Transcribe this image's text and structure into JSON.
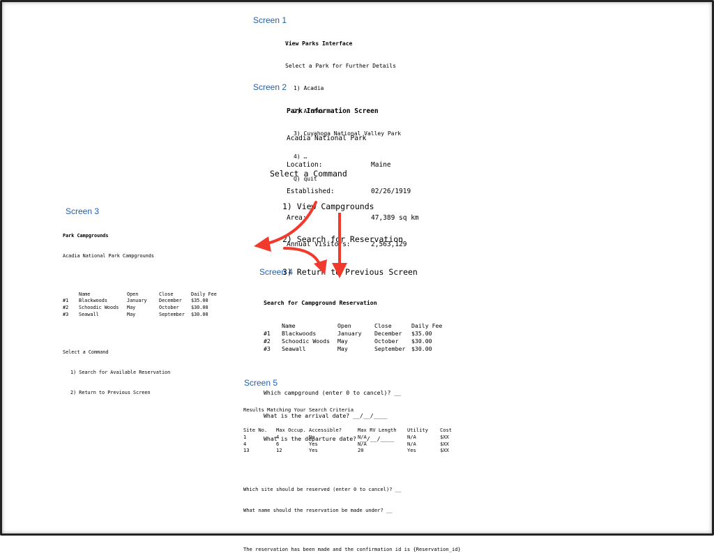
{
  "labels": {
    "screen1": "Screen 1",
    "screen2": "Screen 2",
    "screen3": "Screen 3",
    "screen4": "Screen 4",
    "screen5": "Screen 5"
  },
  "screen1": {
    "title": "View Parks Interface",
    "prompt": "Select a Park for Further Details",
    "options": [
      "1) Acadia",
      "2) Arches",
      "3) Cuyahoga National Valley Park",
      "4) …",
      "Q) quit"
    ]
  },
  "screen2": {
    "title": "Park Information Screen",
    "park": "Acadia National Park",
    "fields": [
      {
        "k": "Location:",
        "v": "Maine"
      },
      {
        "k": "Established:",
        "v": "02/26/1919"
      },
      {
        "k": "Area:",
        "v": "47,389 sq km"
      },
      {
        "k": "Annual Visitors:",
        "v": "2,563,129"
      }
    ],
    "command_title": "Select a Command",
    "commands": [
      "1) View Campgrounds",
      "2) Search for Reservation",
      "3) Return to Previous Screen"
    ]
  },
  "screen3": {
    "title": "Park Campgrounds",
    "subtitle": "Acadia National Park Campgrounds",
    "headers": [
      "",
      "Name",
      "Open",
      "Close",
      "Daily Fee"
    ],
    "rows": [
      [
        "#1",
        "Blackwoods",
        "January",
        "December",
        "$35.00"
      ],
      [
        "#2",
        "Schoodic Woods",
        "May",
        "October",
        "$30.00"
      ],
      [
        "#3",
        "Seawall",
        "May",
        "September",
        "$30.00"
      ]
    ],
    "command_title": "Select a Command",
    "commands": [
      "1) Search for Available Reservation",
      "2) Return to Previous Screen"
    ]
  },
  "screen4": {
    "title": "Search for Campground Reservation",
    "headers": [
      "",
      "Name",
      "Open",
      "Close",
      "Daily Fee"
    ],
    "rows": [
      [
        "#1",
        "Blackwoods",
        "January",
        "December",
        "$35.00"
      ],
      [
        "#2",
        "Schoodic Woods",
        "May",
        "October",
        "$30.00"
      ],
      [
        "#3",
        "Seawall",
        "May",
        "September",
        "$30.00"
      ]
    ],
    "prompts": [
      "Which campground (enter 0 to cancel)? __",
      "What is the arrival date? __/__/____",
      "What is the departure date? __/__/____"
    ]
  },
  "screen5": {
    "title": "Results Matching Your Search Criteria",
    "headers": [
      "Site No.",
      "Max Occup.",
      "Accessible?",
      "Max RV Length",
      "Utility",
      "Cost"
    ],
    "rows": [
      [
        "1",
        "4",
        "No",
        "N/A",
        "N/A",
        "$XX"
      ],
      [
        "4",
        "6",
        "Yes",
        "N/A",
        "N/A",
        "$XX"
      ],
      [
        "13",
        "12",
        "Yes",
        "20",
        "Yes",
        "$XX"
      ]
    ],
    "prompts": [
      "Which site should be reserved (enter 0 to cancel)? __",
      "What name should the reservation be made under? __"
    ],
    "confirmation": "The reservation has been made and the confirmation id is {Reservation_id}"
  },
  "colors": {
    "label": "#1f5fae",
    "arrow": "#f03a2e",
    "frame": "#222222"
  }
}
